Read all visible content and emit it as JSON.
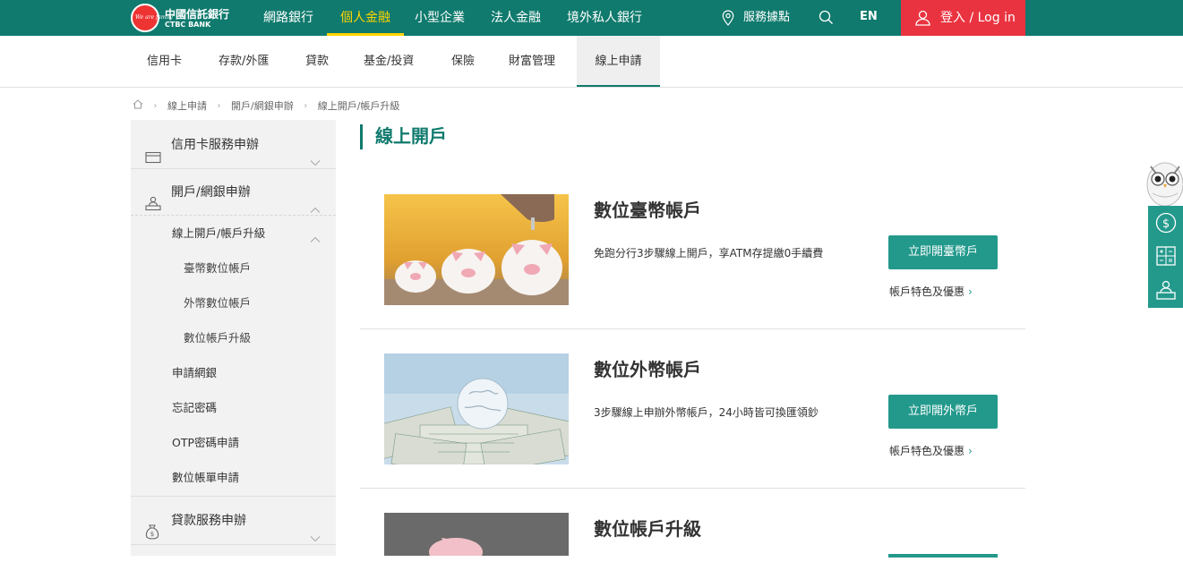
{
  "header": {
    "logo_cn": "中國信託銀行",
    "logo_en": "CTBC BANK",
    "logo_script": "We are family",
    "nav": [
      "網路銀行",
      "個人金融",
      "小型企業",
      "法人金融",
      "境外私人銀行"
    ],
    "active_nav": "個人金融",
    "service_points": "服務據點",
    "lang": "EN",
    "login": "登入 / Log in"
  },
  "subnav": {
    "items": [
      "信用卡",
      "存款/外匯",
      "貸款",
      "基金/投資",
      "保險",
      "財富管理",
      "線上申請"
    ],
    "active": "線上申請"
  },
  "breadcrumb": [
    "線上申請",
    "開戶/網銀申辦",
    "線上開戶/帳戶升級"
  ],
  "sidebar": {
    "sections": [
      {
        "label": "信用卡服務申辦",
        "icon": "credit-card-icon",
        "expanded": false
      },
      {
        "label": "開戶/網銀申辦",
        "icon": "counter-person-icon",
        "expanded": true
      },
      {
        "label": "貸款服務申辦",
        "icon": "money-bag-icon",
        "expanded": false
      }
    ],
    "sub_items": [
      {
        "label": "線上開戶/帳戶升級",
        "expanded": true
      },
      {
        "label": "申請網銀"
      },
      {
        "label": "忘記密碼"
      },
      {
        "label": "OTP密碼申請"
      },
      {
        "label": "數位帳單申請"
      }
    ],
    "sub_sub_items": [
      "臺幣數位帳戶",
      "外幣數位帳戶",
      "數位帳戶升級"
    ]
  },
  "main": {
    "title": "線上開戶",
    "cards": [
      {
        "title": "數位臺幣帳戶",
        "desc": "免跑分行3步驟線上開戶，享ATM存提繳0手續費",
        "button": "立即開臺幣戶",
        "link": "帳戶特色及優惠"
      },
      {
        "title": "數位外幣帳戶",
        "desc": "3步驟線上申辦外幣帳戶，24小時皆可換匯領鈔",
        "button": "立即開外幣戶",
        "link": "帳戶特色及優惠"
      },
      {
        "title": "數位帳戶升級",
        "desc": "",
        "button": "",
        "link": ""
      }
    ]
  },
  "floating_tools": [
    "owl-mascot-icon",
    "dollar-coin-icon",
    "calculator-icon",
    "counter-service-icon"
  ],
  "colors": {
    "brand_green": "#0f7a6d",
    "accent_yellow": "#ffd400",
    "login_red": "#ea3340",
    "button_teal": "#23998c",
    "sidebar_bg": "#f2f2f2"
  }
}
